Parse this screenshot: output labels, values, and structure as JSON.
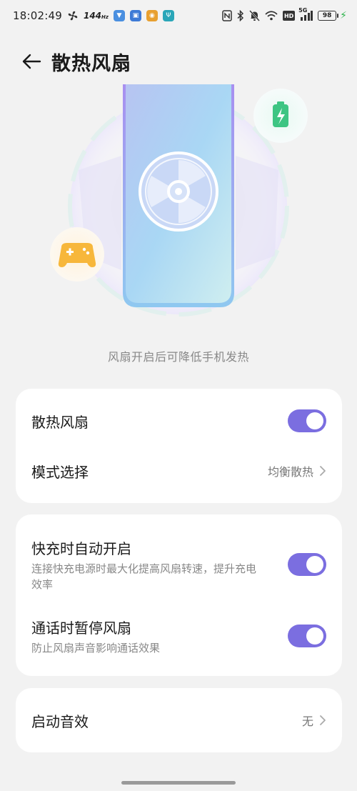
{
  "status_bar": {
    "time": "18:02:49",
    "refresh_rate": "144",
    "refresh_unit": "Hz",
    "hd_label": "HD",
    "network": "5G",
    "battery": "98"
  },
  "header": {
    "title": "散热风扇"
  },
  "hero": {
    "caption": "风扇开启后可降低手机发热"
  },
  "settings": {
    "fan": {
      "label": "散热风扇",
      "enabled": true
    },
    "mode": {
      "label": "模式选择",
      "value": "均衡散热"
    },
    "fast_charge": {
      "label": "快充时自动开启",
      "description": "连接快充电源时最大化提高风扇转速，提升充电效率",
      "enabled": true
    },
    "call_pause": {
      "label": "通话时暂停风扇",
      "description": "防止风扇声音影响通话效果",
      "enabled": true
    },
    "startup_sound": {
      "label": "启动音效",
      "value": "无"
    }
  },
  "colors": {
    "accent": "#7b6ee0",
    "background": "#f2f2f2",
    "card": "#ffffff"
  }
}
